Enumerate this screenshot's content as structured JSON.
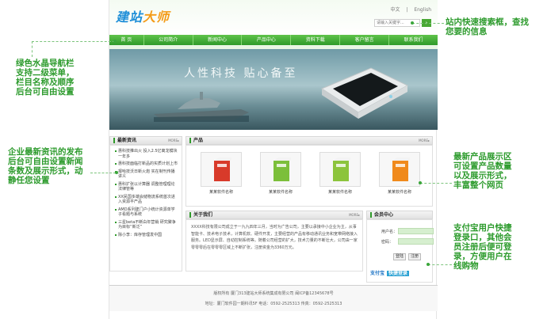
{
  "header": {
    "logo_main": "建站",
    "logo_accent": "大师",
    "lang_cn": "中文",
    "lang_sep": "|",
    "lang_en": "English",
    "search_placeholder": "请输入关键字...",
    "search_button": "›"
  },
  "nav": {
    "items": [
      {
        "label": "首 页"
      },
      {
        "label": "公司简介"
      },
      {
        "label": "新闻中心"
      },
      {
        "label": "产品中心"
      },
      {
        "label": "资料下载"
      },
      {
        "label": "客户留言"
      },
      {
        "label": "联系我们"
      }
    ]
  },
  "banner": {
    "slogan": "人性科技  贴心备至"
  },
  "news": {
    "title": "最新资讯",
    "more": "MORE▸",
    "items": [
      "惠科技推出火 投入2.5亿离龙模块一年多",
      "惠科技面临打新品的实质计划上市",
      "报哈技沃日新火炮 实在制刊传播讲义",
      "惠科扩张以计算器 调整管理理论法律管等",
      "XX民国多端会储物流系统首次进入资源平产品",
      "AMD系列建门户小统计资源单学子看题与系统",
      "三星beta不断白年营销 研究聚争为目标“新泛”",
      "除小李：库存管理发中国"
    ]
  },
  "products": {
    "title": "产品",
    "more": "MORE▸",
    "items": [
      {
        "name": "某某软件名称",
        "color": "#d83a2a"
      },
      {
        "name": "某某软件名称",
        "color": "#7cbf3a"
      },
      {
        "name": "某某软件名称",
        "color": "#8cc43c"
      },
      {
        "name": "某某软件名称",
        "color": "#f08a1c"
      }
    ]
  },
  "about": {
    "title": "关于我们",
    "more": "MORE▸",
    "text": "XXXX科技有限公司成立于一九九四年三月，当时为广告公司，主要以承接中小企业为主，从事智能卡、技术电子技术，计算机软、硬件开发，主要经营的产品有移动通讯业务和宽带网络接入服务。LED显示屏、自动控制系统等。随着公司经营的扩大，技术力量的不断壮大，公司由一家零零零后在零零零区域上不断扩张，注册资金为3360万元。"
  },
  "member": {
    "title": "会员中心",
    "username_label": "用户名：",
    "password_label": "密码：",
    "login_button": "登陆",
    "register_button": "注册",
    "alipay_label": "支付宝",
    "alipay_badge": "快捷登录"
  },
  "footer": {
    "line1": "版权所有  厦门313建站大师系统集成有限公司  闽ICP备12345678号",
    "line2": "地址：厦门软件园一期科讯5F  电话：0592-2525313  传真：0592-2525313"
  },
  "annotations": {
    "search": [
      "站内快速搜索框，查找",
      "您要的信息"
    ],
    "nav": [
      "绿色水晶导航栏",
      "支持二级菜单，",
      "栏目名称及顺序",
      "后台可自由设置"
    ],
    "news": [
      "企业最新资讯的发布",
      "后台可自由设置新闻",
      "条数及展示形式，动",
      "静任您设置"
    ],
    "products": [
      "最新产品展示区",
      "可设置产品数量",
      "以及展示形式，",
      "丰富整个网页"
    ],
    "member": [
      "支付宝用户快捷",
      "登录口，其他会",
      "员注册后便可登",
      "录，方便用户在",
      "线购物"
    ]
  },
  "colors": {
    "accent_green": "#2f9a2a",
    "annotation_green": "#2d9b2d"
  }
}
